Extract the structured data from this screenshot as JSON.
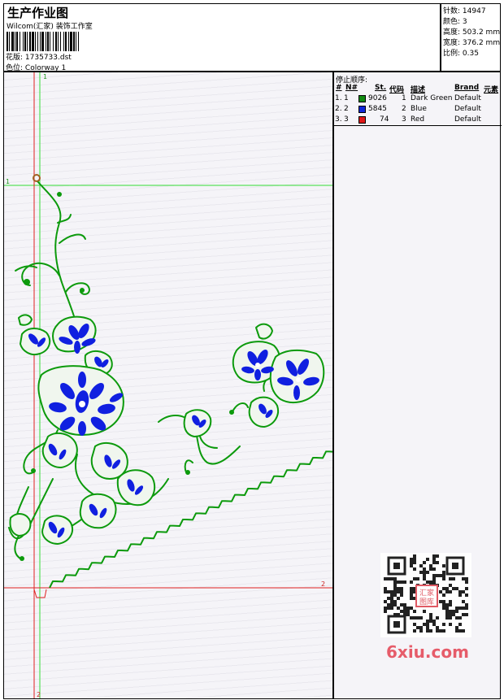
{
  "header": {
    "title": "生产作业图",
    "company": "Wilcom(汇家) 装饰工作室",
    "design_label": "花版:",
    "design_file": "1735733.dst",
    "colorway_label": "色位:",
    "colorway": "Colorway 1"
  },
  "stats": [
    {
      "label": "针数:",
      "value": "14947"
    },
    {
      "label": "颜色:",
      "value": "3"
    },
    {
      "label": "高度:",
      "value": "503.2 mm"
    },
    {
      "label": "宽度:",
      "value": "376.2 mm"
    },
    {
      "label": "比例:",
      "value": "0.35"
    }
  ],
  "stop_sequence": {
    "title": "停止顺序:",
    "headers": [
      "#",
      "N#",
      "St.",
      "代码",
      "描述",
      "Brand",
      "元素"
    ],
    "rows": [
      {
        "num": "1.",
        "n": "1",
        "swatch": "#118a11",
        "stitches": "9026",
        "code": "1",
        "description": "Dark Green",
        "brand": "Default"
      },
      {
        "num": "2.",
        "n": "2",
        "swatch": "#1028d8",
        "stitches": "5845",
        "code": "2",
        "description": "Blue",
        "brand": "Default"
      },
      {
        "num": "3.",
        "n": "3",
        "swatch": "#e01818",
        "stitches": "74",
        "code": "3",
        "description": "Red",
        "brand": "Default"
      }
    ]
  },
  "guides": {
    "green_v": "1",
    "green_h": "1",
    "red_h": "2",
    "red_v": "2"
  },
  "colors": {
    "green": "#0c9a0c",
    "blue": "#1020e0",
    "red": "#e01818",
    "guide_green": "#33dd33",
    "guide_red": "#e02020"
  },
  "watermark": {
    "stamp_text": "汇家图库",
    "site": "6xiu.com"
  }
}
